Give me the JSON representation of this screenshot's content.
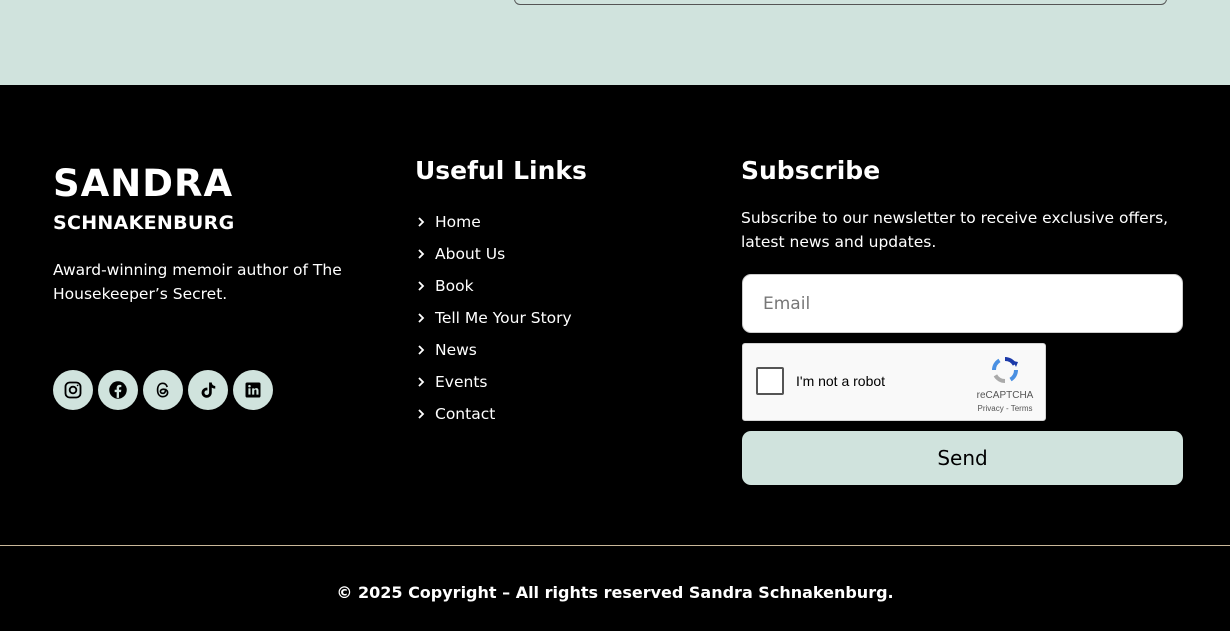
{
  "brand": {
    "name": "SANDRA",
    "subname": "SCHNAKENBURG",
    "description": "Award-winning memoir author of The Housekeeper’s Secret."
  },
  "socials": [
    {
      "icon": "instagram-icon"
    },
    {
      "icon": "facebook-icon"
    },
    {
      "icon": "threads-icon"
    },
    {
      "icon": "tiktok-icon"
    },
    {
      "icon": "linkedin-icon"
    }
  ],
  "useful_links": {
    "title": "Useful Links",
    "items": [
      "Home",
      "About Us",
      "Book",
      "Tell Me Your Story",
      "News",
      "Events",
      "Contact"
    ]
  },
  "subscribe": {
    "title": "Subscribe",
    "description": "Subscribe to our newsletter to receive exclusive offers, latest news and updates.",
    "email_placeholder": "Email",
    "captcha_label": "I'm not a robot",
    "captcha_brand": "reCAPTCHA",
    "captcha_legal": "Privacy - Terms",
    "send_label": "Send"
  },
  "copyright": "© 2025 Copyright – All rights reserved Sandra Schnakenburg.",
  "colors": {
    "accent": "#d0e3dd",
    "background": "#000000",
    "text": "#ffffff"
  }
}
